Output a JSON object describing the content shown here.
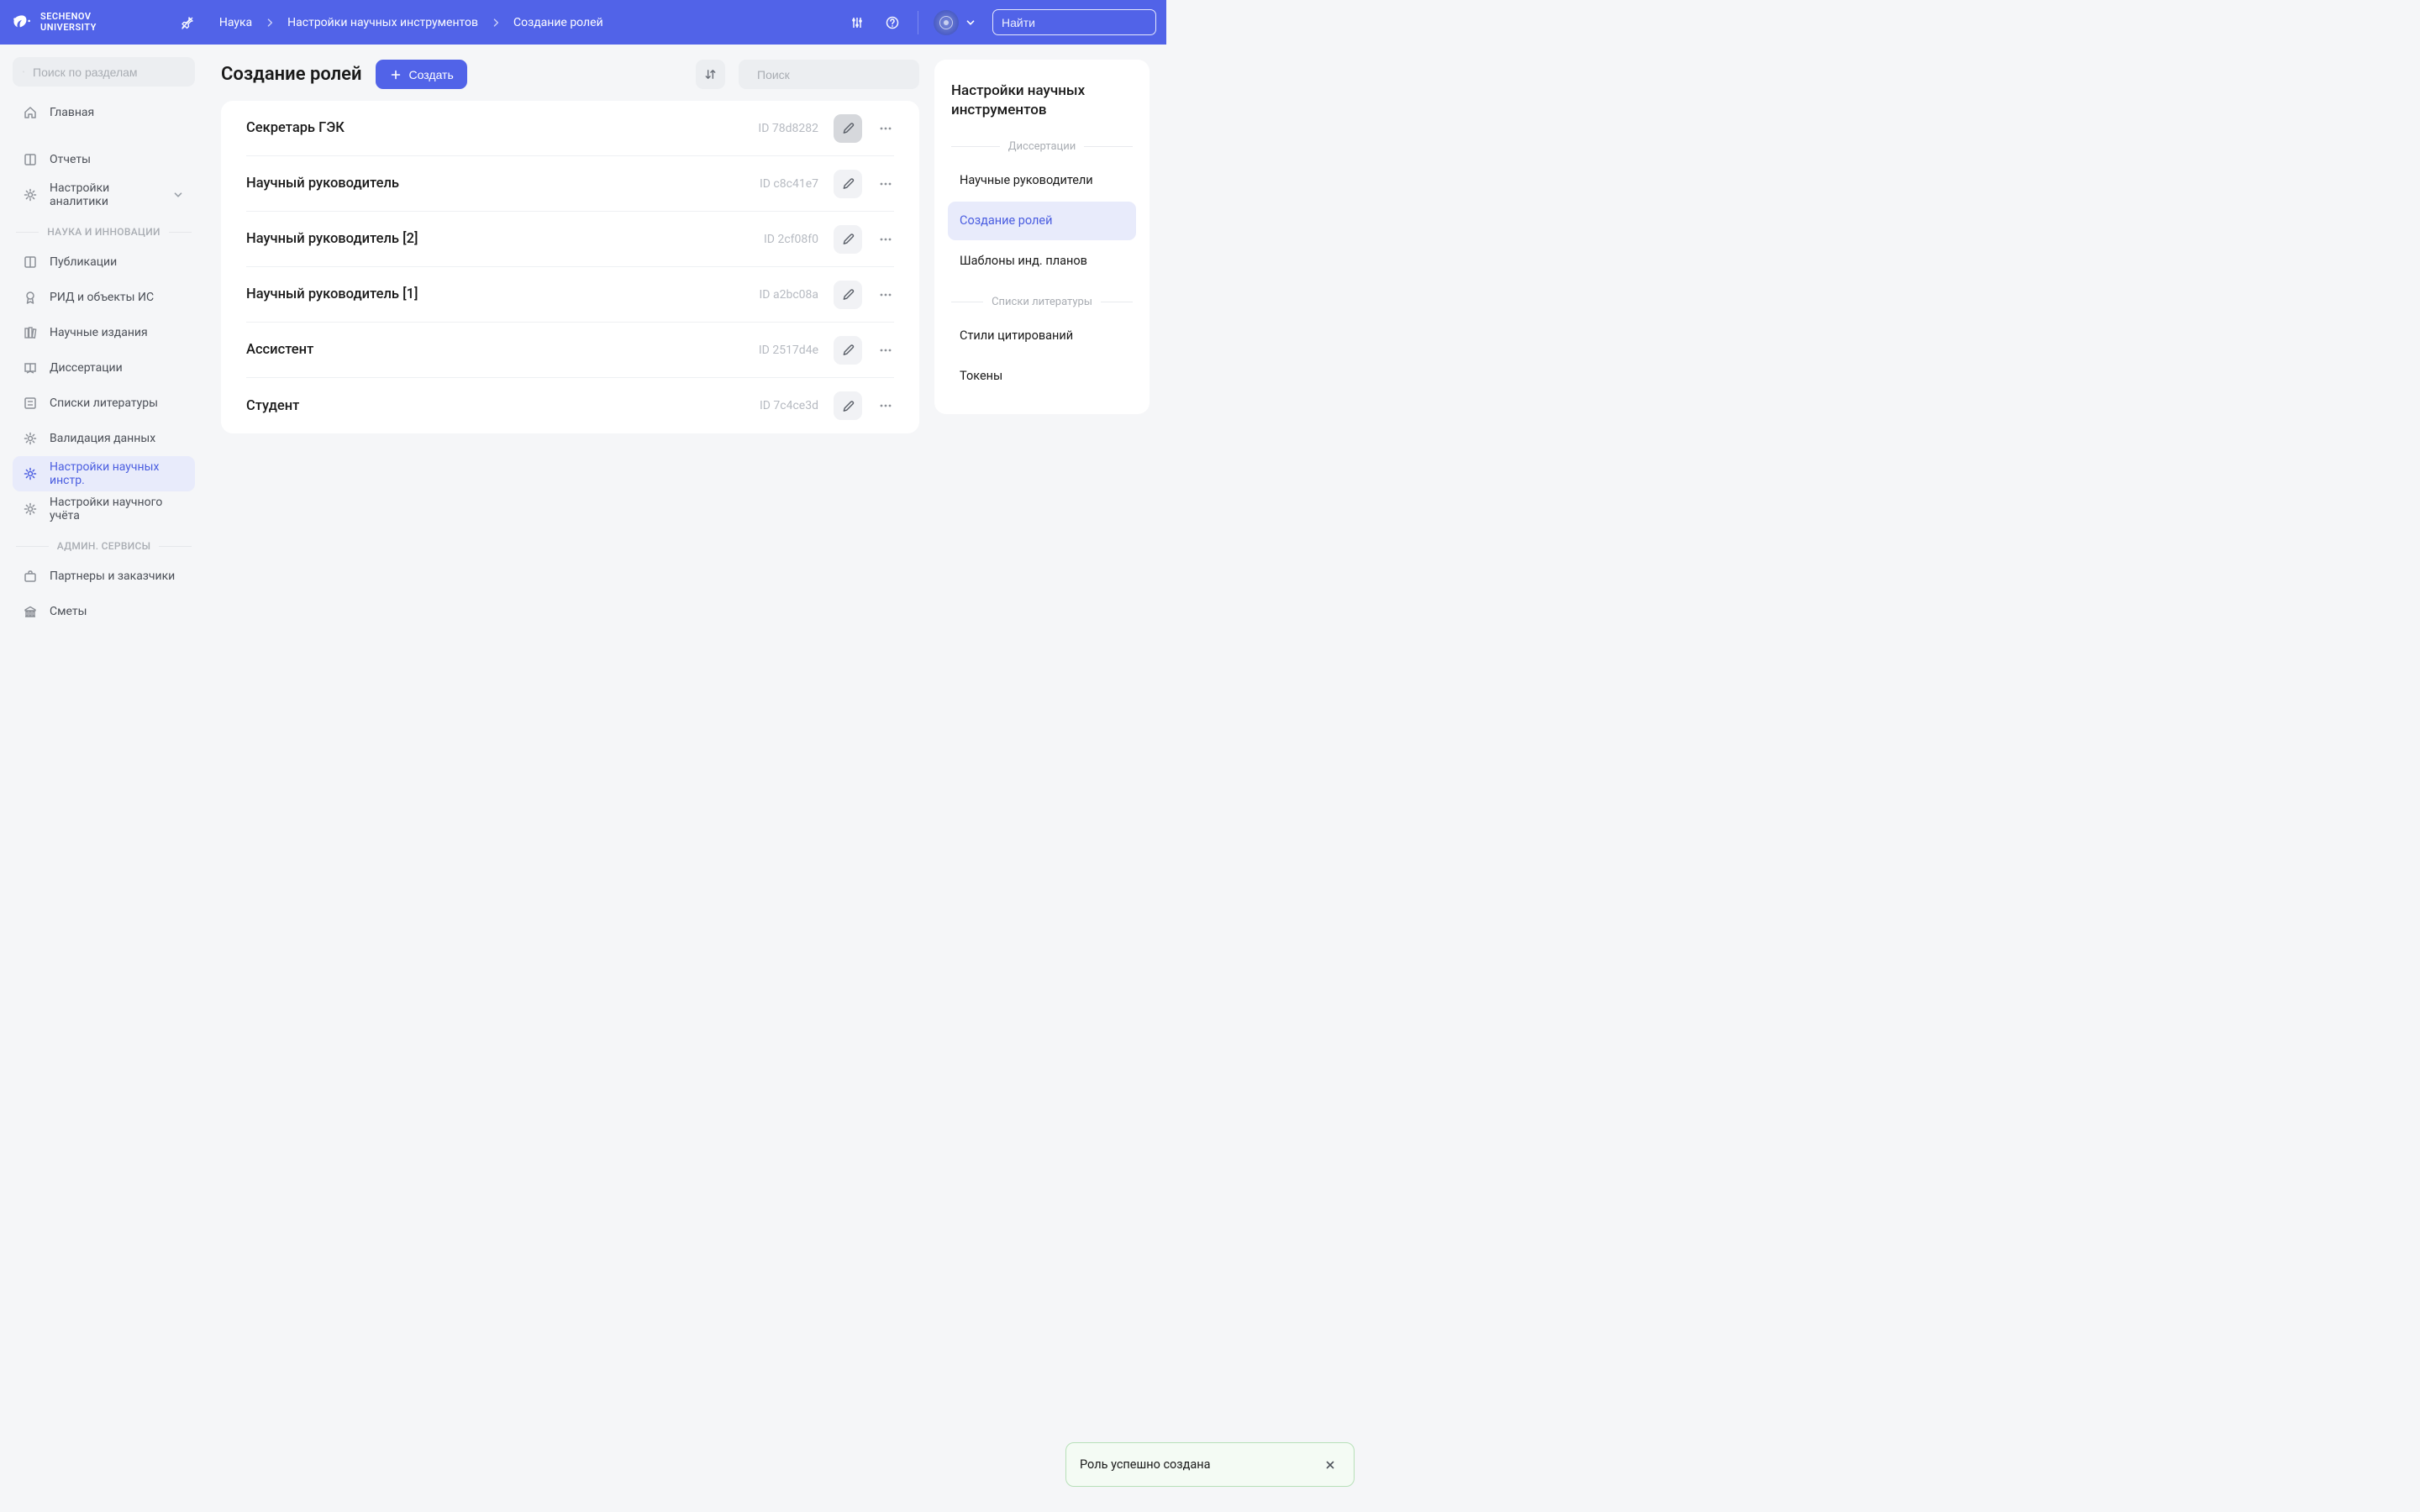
{
  "brand": {
    "line1": "SECHENOV",
    "line2": "UNIVERSITY"
  },
  "breadcrumbs": [
    "Наука",
    "Настройки научных инструментов",
    "Создание ролей"
  ],
  "global_search": {
    "placeholder": "Найти"
  },
  "section_search": {
    "placeholder": "Поиск по разделам"
  },
  "sidebar": {
    "items_top": [
      {
        "label": "Главная",
        "icon": "home"
      }
    ],
    "items_mid": [
      {
        "label": "Отчеты",
        "icon": "book"
      },
      {
        "label": "Настройки аналитики",
        "icon": "gear",
        "chevron": true
      }
    ],
    "group1": "НАУКА И ИННОВАЦИИ",
    "items_sci": [
      {
        "label": "Публикации",
        "icon": "book"
      },
      {
        "label": "РИД и объекты ИС",
        "icon": "award"
      },
      {
        "label": "Научные издания",
        "icon": "books"
      },
      {
        "label": "Диссертации",
        "icon": "diploma"
      },
      {
        "label": "Списки литературы",
        "icon": "list"
      },
      {
        "label": "Валидация данных",
        "icon": "gear"
      },
      {
        "label": "Настройки научных инстр.",
        "icon": "gear",
        "active": true
      },
      {
        "label": "Настройки научного учёта",
        "icon": "gear"
      }
    ],
    "group2": "АДМИН. СЕРВИСЫ",
    "items_admin": [
      {
        "label": "Партнеры и заказчики",
        "icon": "briefcase"
      },
      {
        "label": "Сметы",
        "icon": "bank"
      }
    ]
  },
  "page": {
    "title": "Создание ролей",
    "create_label": "Создать",
    "content_search_placeholder": "Поиск"
  },
  "roles": [
    {
      "name": "Секретарь ГЭК",
      "id": "ID 78d8282",
      "highlight": true
    },
    {
      "name": "Научный руководитель",
      "id": "ID c8c41e7"
    },
    {
      "name": "Научный руководитель [2]",
      "id": "ID 2cf08f0"
    },
    {
      "name": "Научный руководитель [1]",
      "id": "ID a2bc08a"
    },
    {
      "name": "Ассистент",
      "id": "ID 2517d4e"
    },
    {
      "name": "Студент",
      "id": "ID 7c4ce3d"
    }
  ],
  "rpanel": {
    "title": "Настройки научных инструментов",
    "group1": "Диссертации",
    "items1": [
      {
        "label": "Научные руководители"
      },
      {
        "label": "Создание ролей",
        "active": true
      },
      {
        "label": "Шаблоны инд. планов"
      }
    ],
    "group2": "Списки литературы",
    "items2": [
      {
        "label": "Стили цитирований"
      },
      {
        "label": "Токены"
      }
    ]
  },
  "toast": {
    "message": "Роль успешно создана"
  }
}
